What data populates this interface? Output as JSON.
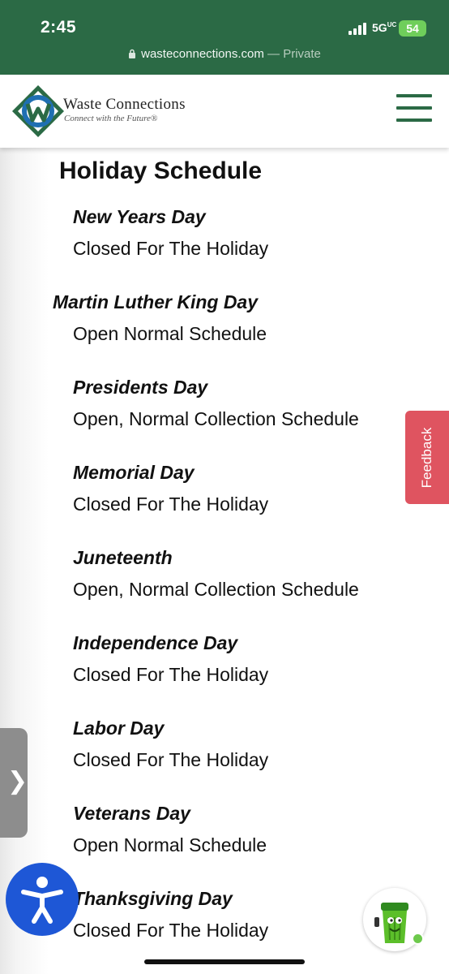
{
  "status_bar": {
    "time": "2:45",
    "network": "5G",
    "network_sub": "UC",
    "battery": "54"
  },
  "browser": {
    "host": "wasteconnections.com",
    "separator": " — ",
    "mode": "Private"
  },
  "site_header": {
    "logo_name": "Waste Connections",
    "logo_tagline": "Connect with the Future®",
    "brand_color": "#2b6a45",
    "accent_color": "#1f6fb2"
  },
  "page": {
    "title": "Holiday Schedule",
    "holidays": [
      {
        "name": "New Years Day",
        "status": "Closed For The Holiday"
      },
      {
        "name": "Martin Luther King Day",
        "status": "Open Normal Schedule"
      },
      {
        "name": "Presidents Day",
        "status": "Open, Normal Collection Schedule"
      },
      {
        "name": "Memorial Day",
        "status": "Closed For The Holiday"
      },
      {
        "name": "Juneteenth",
        "status": "Open, Normal Collection Schedule"
      },
      {
        "name": "Independence Day",
        "status": "Closed For The Holiday"
      },
      {
        "name": "Labor Day",
        "status": "Closed For The Holiday"
      },
      {
        "name": "Veterans Day",
        "status": "Open Normal Schedule"
      },
      {
        "name": "Thanksgiving Day",
        "status": "Closed For The Holiday"
      }
    ]
  },
  "widgets": {
    "feedback_label": "Feedback",
    "feedback_color": "#df5460",
    "side_handle_glyph": "❯",
    "accessibility_icon": "accessibility-person-icon",
    "accessibility_color": "#1e57d6",
    "chat_icon": "mascot-trash-can-icon",
    "online_color": "#6dc94c"
  }
}
